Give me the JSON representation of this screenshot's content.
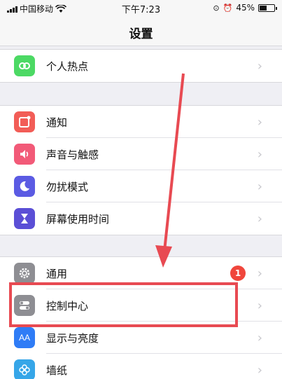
{
  "status_bar": {
    "carrier": "中国移动",
    "time": "下午7:23",
    "battery_percent": "45%"
  },
  "nav": {
    "title": "设置"
  },
  "groups": [
    [
      {
        "label": "个人热点",
        "icon": "personal-hotspot-icon",
        "color": "#4cd964"
      }
    ],
    [
      {
        "label": "通知",
        "icon": "notifications-icon",
        "color": "#f25d57"
      },
      {
        "label": "声音与触感",
        "icon": "sounds-icon",
        "color": "#f25a78"
      },
      {
        "label": "勿扰模式",
        "icon": "do-not-disturb-icon",
        "color": "#5b5be3"
      },
      {
        "label": "屏幕使用时间",
        "icon": "screen-time-icon",
        "color": "#5b4fd6"
      }
    ],
    [
      {
        "label": "通用",
        "icon": "gear-icon",
        "color": "#8e8e93",
        "badge": "1"
      },
      {
        "label": "控制中心",
        "icon": "control-center-icon",
        "color": "#8e8e93"
      },
      {
        "label": "显示与亮度",
        "icon": "display-icon",
        "color": "#2f7cf6"
      },
      {
        "label": "墙纸",
        "icon": "wallpaper-icon",
        "color": "#36a6e8"
      }
    ]
  ],
  "annotation": {
    "color": "#e84a52"
  }
}
